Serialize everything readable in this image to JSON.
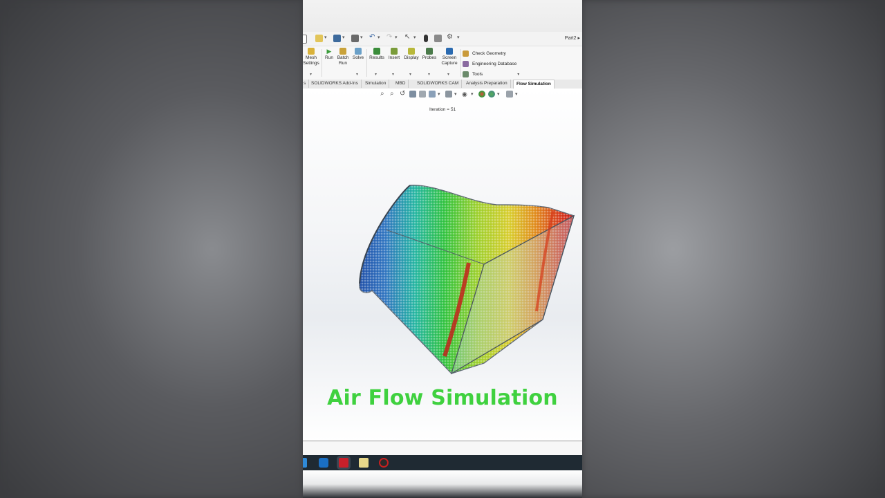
{
  "quick_access": {
    "document_name": "Part2",
    "icons": [
      "new-icon",
      "open-icon",
      "save-icon",
      "print-icon",
      "undo-icon",
      "redo-icon",
      "select-icon",
      "rebuild-icon",
      "file-properties-icon",
      "options-icon"
    ]
  },
  "ribbon": {
    "buttons": [
      {
        "label_line1": "Mesh",
        "label_line2": "Settings",
        "icon": "mesh-settings-icon",
        "color": "#d9b23a"
      },
      {
        "label_line1": "Run",
        "label_line2": "",
        "icon": "run-icon",
        "color": "#3a9c3a"
      },
      {
        "label_line1": "Batch",
        "label_line2": "Run",
        "icon": "batch-run-icon",
        "color": "#c9a23a"
      },
      {
        "label_line1": "Solve",
        "label_line2": "",
        "icon": "solve-icon",
        "color": "#6aa0c8"
      },
      {
        "label_line1": "Results",
        "label_line2": "",
        "icon": "results-icon",
        "color": "#3a8c3a"
      },
      {
        "label_line1": "Insert",
        "label_line2": "",
        "icon": "insert-icon",
        "color": "#7a9c3a"
      },
      {
        "label_line1": "Display",
        "label_line2": "",
        "icon": "display-icon",
        "color": "#b8b83a"
      },
      {
        "label_line1": "Probes",
        "label_line2": "",
        "icon": "probes-icon",
        "color": "#4a7a4a"
      },
      {
        "label_line1": "Screen",
        "label_line2": "Capture",
        "icon": "screen-capture-icon",
        "color": "#2a6ab0"
      }
    ],
    "list_items": [
      {
        "label": "Check Geometry",
        "icon": "check-geometry-icon",
        "color": "#c99a3a"
      },
      {
        "label": "Engineering Database",
        "icon": "engineering-database-icon",
        "color": "#8a6aa0"
      },
      {
        "label": "Tools",
        "icon": "tools-icon",
        "color": "#6a8a6a"
      }
    ]
  },
  "tabs": [
    {
      "label": "s",
      "active": false
    },
    {
      "label": "SOLIDWORKS Add-Ins",
      "active": false
    },
    {
      "label": "Simulation",
      "active": false
    },
    {
      "label": "MBD",
      "active": false
    },
    {
      "label": "SOLIDWORKS CAM",
      "active": false
    },
    {
      "label": "Analysis Preparation",
      "active": false
    },
    {
      "label": "Flow Simulation",
      "active": true
    }
  ],
  "viewport": {
    "iteration_text": "Iteration = 51",
    "caption": "Air Flow Simulation",
    "caption_color": "#3fd13f",
    "view_tools": [
      "zoom-to-fit-icon",
      "zoom-to-area-icon",
      "previous-view-icon",
      "section-view-icon",
      "dynamic-annotation-icon",
      "view-orientation-icon",
      "display-style-icon",
      "hide-show-icon",
      "edit-appearance-icon",
      "apply-scene-icon",
      "view-settings-icon"
    ]
  },
  "taskbar": {
    "apps": [
      "windows-explorer-icon",
      "outlook-icon",
      "solidworks-icon",
      "notes-icon",
      "screen-recorder-icon"
    ]
  }
}
